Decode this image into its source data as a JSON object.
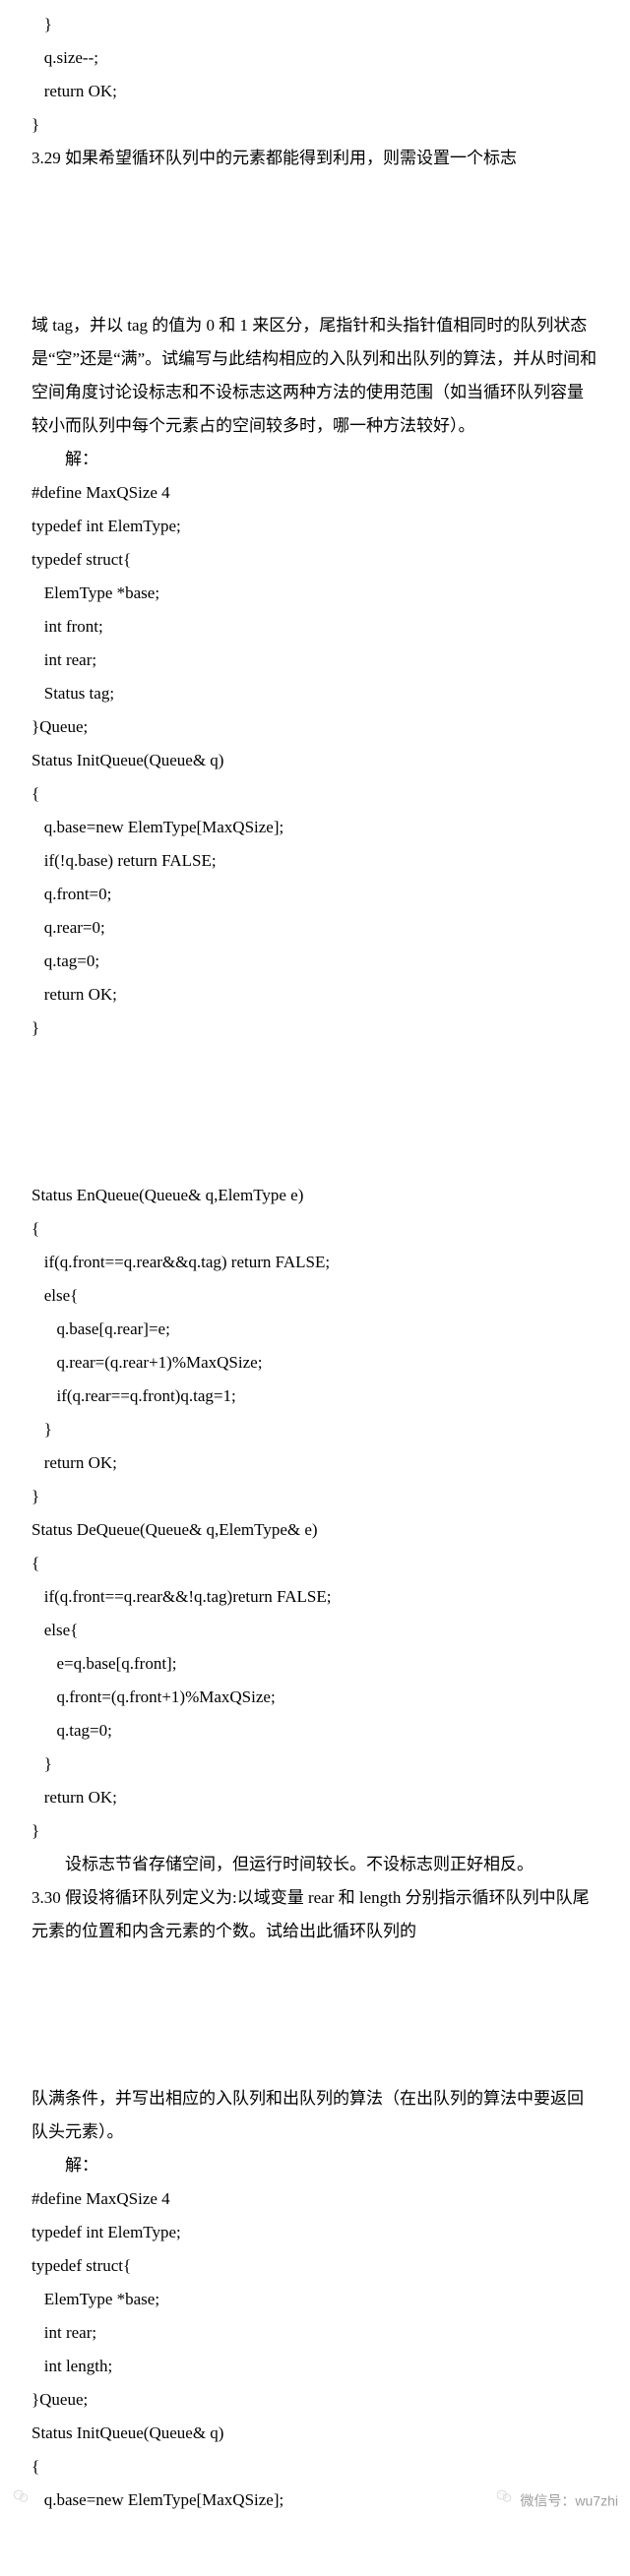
{
  "content": "   }\n   q.size--;\n   return OK;\n}\n3.29 如果希望循环队列中的元素都能得到利用，则需设置一个标志\n\n\n\n\n域 tag，并以 tag 的值为 0 和 1 来区分，尾指针和头指针值相同时的队列状态是“空”还是“满”。试编写与此结构相应的入队列和出队列的算法，并从时间和空间角度讨论设标志和不设标志这两种方法的使用范围（如当循环队列容量较小而队列中每个元素占的空间较多时，哪一种方法较好）。\n        解：\n#define MaxQSize 4\ntypedef int ElemType;\ntypedef struct{\n   ElemType *base;\n   int front;\n   int rear;\n   Status tag;\n}Queue;\nStatus InitQueue(Queue& q)\n{\n   q.base=new ElemType[MaxQSize];\n   if(!q.base) return FALSE;\n   q.front=0;\n   q.rear=0;\n   q.tag=0;\n   return OK;\n}\n\n\n\n\nStatus EnQueue(Queue& q,ElemType e)\n{\n   if(q.front==q.rear&&q.tag) return FALSE;\n   else{\n      q.base[q.rear]=e;\n      q.rear=(q.rear+1)%MaxQSize;\n      if(q.rear==q.front)q.tag=1;\n   }\n   return OK;\n}\nStatus DeQueue(Queue& q,ElemType& e)\n{\n   if(q.front==q.rear&&!q.tag)return FALSE;\n   else{\n      e=q.base[q.front];\n      q.front=(q.front+1)%MaxQSize;\n      q.tag=0;\n   }\n   return OK;\n}\n        设标志节省存储空间，但运行时间较长。不设标志则正好相反。\n3.30 假设将循环队列定义为:以域变量 rear 和 length 分别指示循环队列中队尾元素的位置和内含元素的个数。试给出此循环队列的\n\n\n\n\n队满条件，并写出相应的入队列和出队列的算法（在出队列的算法中要返回队头元素）。\n        解：\n#define MaxQSize 4\ntypedef int ElemType;\ntypedef struct{\n   ElemType *base;\n   int rear;\n   int length;\n}Queue;\nStatus InitQueue(Queue& q)\n{\n   q.base=new ElemType[MaxQSize];",
  "footer": {
    "left": {
      "icon": "wechat-icon",
      "label": ""
    },
    "right": {
      "icon": "wechat-icon",
      "label": "微信号：wu7zhi"
    }
  }
}
